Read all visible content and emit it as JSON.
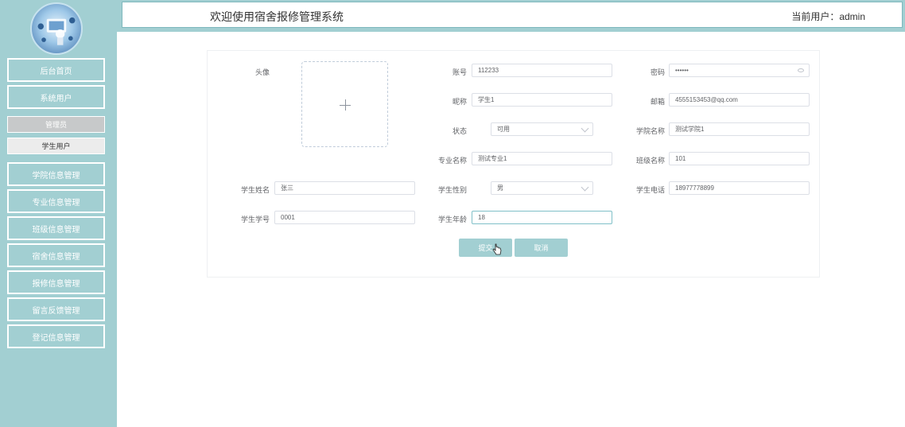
{
  "header": {
    "title": "欢迎使用宿舍报修管理系统",
    "current_user": "当前用户：admin"
  },
  "sidebar": {
    "items": [
      {
        "label": "后台首页"
      },
      {
        "label": "系统用户"
      },
      {
        "label": "管理员"
      },
      {
        "label": "学生用户"
      },
      {
        "label": "学院信息管理"
      },
      {
        "label": "专业信息管理"
      },
      {
        "label": "班级信息管理"
      },
      {
        "label": "宿舍信息管理"
      },
      {
        "label": "报修信息管理"
      },
      {
        "label": "留言反馈管理"
      },
      {
        "label": "登记信息管理"
      }
    ]
  },
  "form": {
    "avatar_label": "头像",
    "account": {
      "label": "账号",
      "value": "112233"
    },
    "password": {
      "label": "密码",
      "value": "••••••"
    },
    "nickname": {
      "label": "昵称",
      "value": "学生1"
    },
    "email": {
      "label": "邮箱",
      "value": "4555153453@qq.com"
    },
    "status": {
      "label": "状态",
      "value": "可用"
    },
    "college": {
      "label": "学院名称",
      "value": "测试学院1"
    },
    "major": {
      "label": "专业名称",
      "value": "测试专业1"
    },
    "class": {
      "label": "班级名称",
      "value": "101"
    },
    "student_name": {
      "label": "学生姓名",
      "value": "张三"
    },
    "gender": {
      "label": "学生性别",
      "value": "男"
    },
    "phone": {
      "label": "学生电话",
      "value": "18977778899"
    },
    "student_no": {
      "label": "学生学号",
      "value": "0001"
    },
    "age": {
      "label": "学生年龄",
      "value": "18"
    },
    "submit_label": "提交",
    "cancel_label": "取消"
  },
  "colors": {
    "accent": "#a2cfd2",
    "border": "#dcdfe6"
  }
}
